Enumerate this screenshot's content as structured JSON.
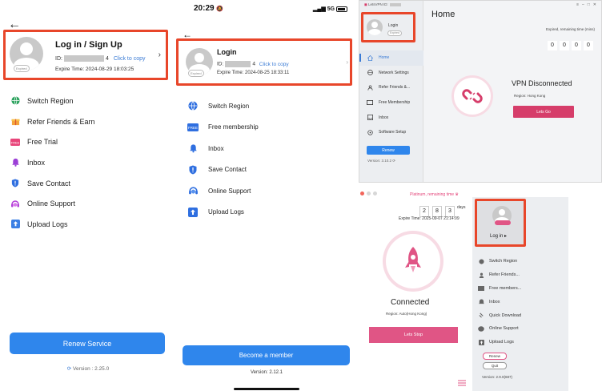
{
  "mobile_old": {
    "back_label": "←",
    "account": {
      "title": "Log in / Sign Up",
      "id_label": "ID:",
      "id_suffix": "4",
      "copy_label": "Click to copy",
      "expire": "Expire Time: 2024-08-29 18:03:25",
      "badge": "Expired"
    },
    "menu": [
      {
        "label": "Switch Region",
        "icon": "globe-icon"
      },
      {
        "label": "Refer Friends & Earn",
        "icon": "gift-icon"
      },
      {
        "label": "Free Trial",
        "icon": "free-icon"
      },
      {
        "label": "Inbox",
        "icon": "bell-icon"
      },
      {
        "label": "Save Contact",
        "icon": "shield-icon"
      },
      {
        "label": "Online Support",
        "icon": "headset-icon"
      },
      {
        "label": "Upload Logs",
        "icon": "upload-icon"
      }
    ],
    "renew_label": "Renew Service",
    "version": "Version : 2.25.0"
  },
  "mobile_new": {
    "status_time": "20:29",
    "status_signal": "5G",
    "account": {
      "title": "Login",
      "id_label": "ID:",
      "id_suffix": "4",
      "copy_label": "Click to copy",
      "expire": "Expire Time: 2024-08-25 18:33:11",
      "badge": "Expired"
    },
    "menu": [
      {
        "label": "Switch Region",
        "icon": "globe-icon"
      },
      {
        "label": "Free membership",
        "icon": "free-icon"
      },
      {
        "label": "Inbox",
        "icon": "bell-icon"
      },
      {
        "label": "Save Contact",
        "icon": "shield-icon"
      },
      {
        "label": "Online Support",
        "icon": "headset-icon"
      },
      {
        "label": "Upload Logs",
        "icon": "upload-icon"
      }
    ],
    "member_label": "Become a member",
    "version": "Version: 2.12.1"
  },
  "desktop_home": {
    "window_title": "LetsVPN ID:",
    "profile_name": "Login",
    "profile_badge": "Expired",
    "menu": [
      {
        "label": "Home",
        "icon": "home-icon",
        "active": true
      },
      {
        "label": "Network Settings",
        "icon": "network-icon"
      },
      {
        "label": "Refer Friends &...",
        "icon": "friends-icon"
      },
      {
        "label": "Free Membership",
        "icon": "card-icon"
      },
      {
        "label": "Inbox",
        "icon": "inbox-icon"
      },
      {
        "label": "Software Setup",
        "icon": "settings-icon"
      }
    ],
    "renew_label": "Renew",
    "version": "Version: 3.10.2",
    "page_title": "Home",
    "remaining_label": "Expired, remaining time (mins)",
    "remaining_digits": [
      "0",
      "0",
      "0",
      "0"
    ],
    "status": "VPN Disconnected",
    "region": "Region: Hong Kong",
    "go_label": "Lets Go",
    "colors": {
      "accent": "#d63d6a",
      "blue": "#2f86ec"
    }
  },
  "desktop_connected": {
    "plan": "Platinum, remaining time",
    "digits": [
      "2",
      "8",
      "3"
    ],
    "days_label": "days",
    "expire": "Expire Time: 2025-09-07 21:14:09",
    "status": "Connected",
    "region": "Region: Auto(Hong Kong)",
    "stop_label": "Lets Stop",
    "login_label": "Log in",
    "menu": [
      {
        "label": "Switch Region",
        "icon": "globe-icon"
      },
      {
        "label": "Refer Friends...",
        "icon": "friends-icon"
      },
      {
        "label": "Free members...",
        "icon": "card-icon"
      },
      {
        "label": "Inbox",
        "icon": "inbox-icon"
      },
      {
        "label": "Quick Download",
        "icon": "download-icon"
      },
      {
        "label": "Online Support",
        "icon": "headset-icon"
      },
      {
        "label": "Upload Logs",
        "icon": "upload-icon"
      }
    ],
    "renew_label": "Renew",
    "quit_label": "Quit",
    "version": "Version: 2.9.0(687)"
  }
}
